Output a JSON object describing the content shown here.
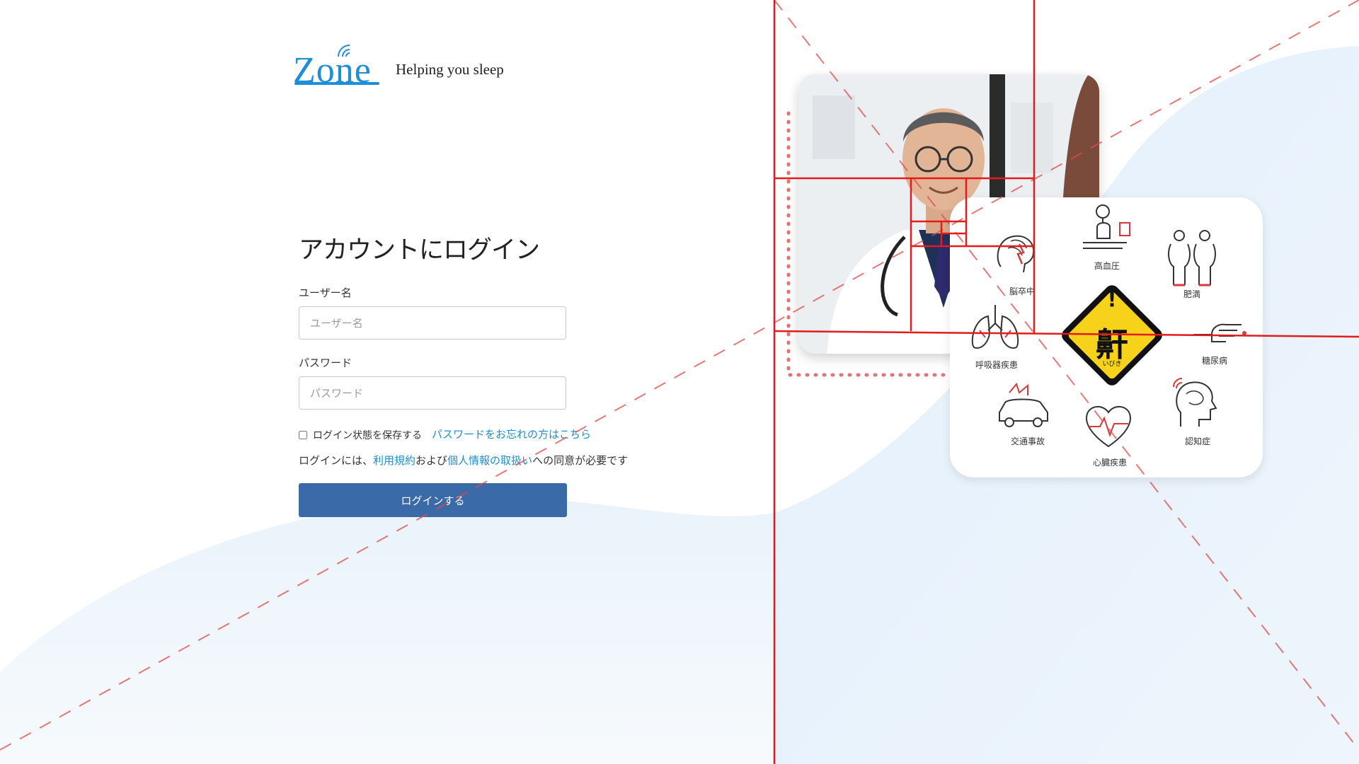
{
  "brand": {
    "logo_text": "Zone",
    "tagline": "Helping you sleep",
    "color": "#1d8fd8"
  },
  "login": {
    "title": "アカウントにログイン",
    "username_label": "ユーザー名",
    "username_placeholder": "ユーザー名",
    "username_value": "",
    "password_label": "パスワード",
    "password_placeholder": "パスワード",
    "password_value": "",
    "remember_label": "ログイン状態を保存する",
    "remember_checked": false,
    "forgot_link": "パスワードをお忘れの方はこちら",
    "terms_prefix": "ログインには、",
    "terms_link": "利用規約",
    "terms_and": "および",
    "privacy_link": "個人情報の取扱い",
    "terms_suffix": "への同意が必要です",
    "submit_label": "ログインする",
    "button_color": "#3b6aa8",
    "link_color": "#1a8fd1"
  },
  "illustration": {
    "center_sign_text": "鼾",
    "center_sign_small": "いびき",
    "center_sign_mark": "!",
    "diseases": [
      {
        "label": "脳卒中",
        "icon": "brain-stroke-icon"
      },
      {
        "label": "高血圧",
        "icon": "blood-pressure-icon"
      },
      {
        "label": "肥満",
        "icon": "obesity-icon"
      },
      {
        "label": "呼吸器疾患",
        "icon": "lungs-icon"
      },
      {
        "label": "糖尿病",
        "icon": "finger-prick-icon"
      },
      {
        "label": "交通事故",
        "icon": "car-crash-icon"
      },
      {
        "label": "心臓疾患",
        "icon": "heart-icon"
      },
      {
        "label": "認知症",
        "icon": "dementia-head-icon"
      }
    ]
  }
}
